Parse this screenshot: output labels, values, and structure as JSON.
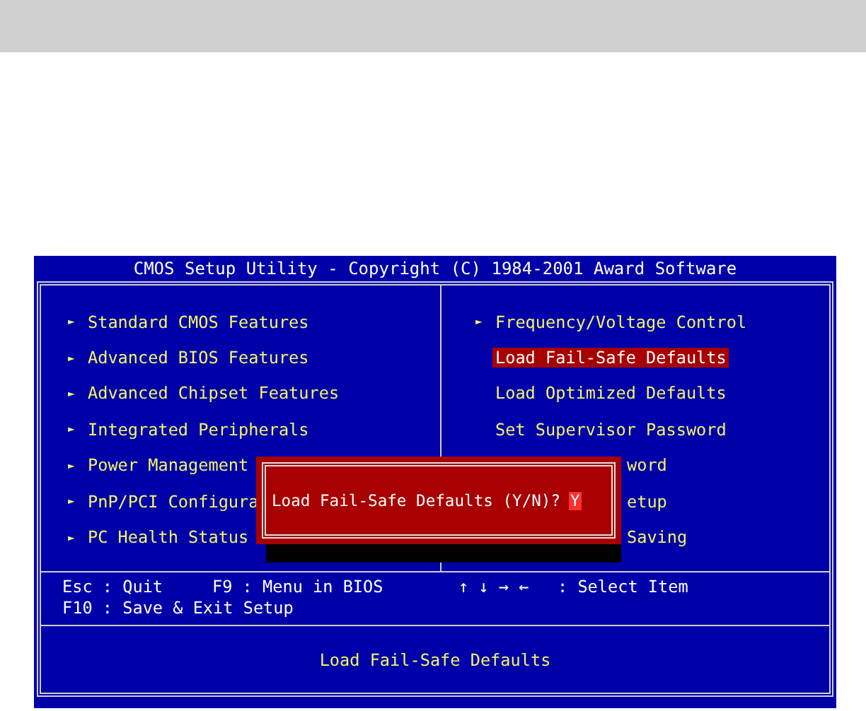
{
  "title": "CMOS Setup Utility - Copyright (C) 1984-2001 Award Software",
  "left_menu": [
    {
      "marker": "►",
      "label": "Standard CMOS Features",
      "selected": false
    },
    {
      "marker": "►",
      "label": "Advanced BIOS Features",
      "selected": false
    },
    {
      "marker": "►",
      "label": "Advanced Chipset Features",
      "selected": false
    },
    {
      "marker": "►",
      "label": "Integrated Peripherals",
      "selected": false
    },
    {
      "marker": "►",
      "label": "Power Management",
      "selected": false
    },
    {
      "marker": "►",
      "label": "PnP/PCI Configura",
      "selected": false
    },
    {
      "marker": "►",
      "label": "PC Health Status",
      "selected": false
    }
  ],
  "right_menu": [
    {
      "kind": "full",
      "marker": "►",
      "label": "Frequency/Voltage Control",
      "selected": false
    },
    {
      "kind": "full",
      "label": "Load Fail-Safe Defaults",
      "selected": true
    },
    {
      "kind": "full",
      "label": "Load Optimized Defaults",
      "selected": false
    },
    {
      "kind": "full",
      "label": "Set Supervisor Password",
      "selected": false
    },
    {
      "kind": "partial",
      "label": "word",
      "selected": false
    },
    {
      "kind": "partial",
      "label": "etup",
      "selected": false
    },
    {
      "kind": "partial",
      "label": "Saving",
      "selected": false
    }
  ],
  "dialog": {
    "prompt": "Load Fail-Safe Defaults (Y/N)?",
    "value": "Y"
  },
  "help_lines": [
    [
      "Esc : Quit",
      "F9 : Menu in BIOS",
      "↑ ↓ → ←",
      ": Select Item"
    ],
    [
      "F10 : Save & Exit Setup"
    ]
  ],
  "status": "Load Fail-Safe Defaults"
}
